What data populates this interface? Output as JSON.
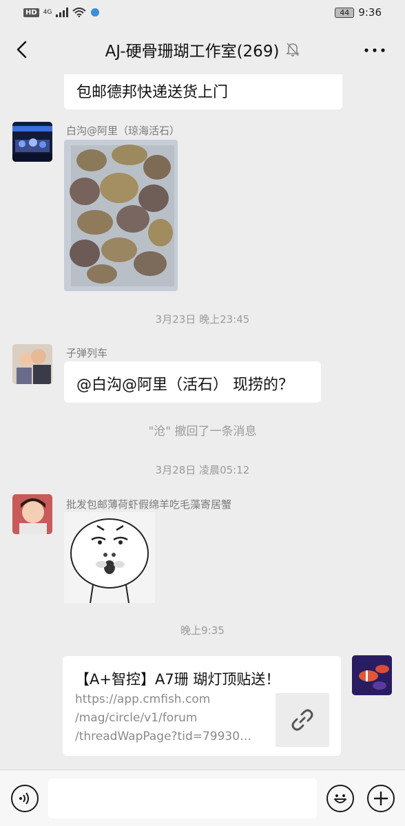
{
  "status_bar": {
    "hd": "HD",
    "network": "4G",
    "battery": "44",
    "time": "9:36"
  },
  "header": {
    "title": "AJ-硬骨珊瑚工作室(269)",
    "back_icon": "chevron-left-icon",
    "mute_icon": "bell-off-icon",
    "more_icon": "more-dots-icon"
  },
  "messages": {
    "m1": {
      "text": "包邮德邦快递送货上门"
    },
    "m2": {
      "sender": "白沟@阿里（琼海活石）",
      "image": "live-rock-photo"
    },
    "ts1": "3月23日 晚上23:45",
    "m3": {
      "sender": "子弹列车",
      "text": "@白沟@阿里（活石） 现捞的？"
    },
    "sys1": "\"沧\" 撤回了一条消息",
    "ts2": "3月28日 凌晨05:12",
    "m4": {
      "sender": "批发包邮薄荷虾假绵羊吃毛藻寄居蟹",
      "image": "meme-sticker"
    },
    "ts3": "晚上9:35",
    "m5": {
      "link_title": "【A+智控】A7珊 瑚灯顶贴送！",
      "link_url": "https://app.cmfish.com\n/mag/circle/v1/forum\n/threadWapPage?tid=79930…",
      "link_icon": "link-icon"
    }
  },
  "input_bar": {
    "voice_icon": "voice-icon",
    "emoji_icon": "emoji-icon",
    "plus_icon": "plus-icon",
    "placeholder": ""
  },
  "colors": {
    "background": "#ededed",
    "bubble": "#ffffff",
    "muted_text": "#9a9a9a"
  }
}
